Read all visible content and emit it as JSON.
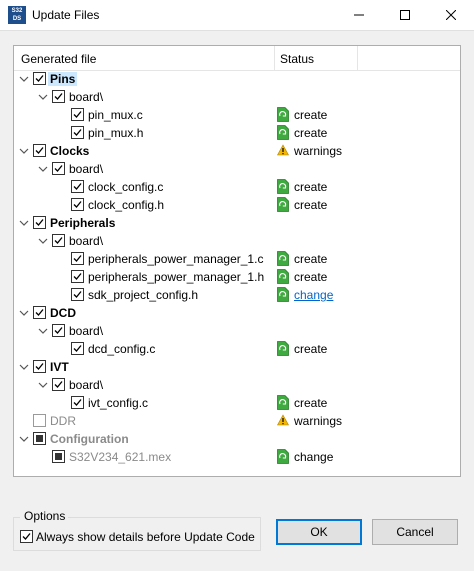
{
  "window": {
    "title": "Update Files",
    "app_icon_text": [
      "S32",
      "DS"
    ]
  },
  "columns": {
    "file": "Generated file",
    "status": "Status"
  },
  "tree": [
    {
      "depth": 0,
      "label": "Pins",
      "chevron": true,
      "check": "checked",
      "bold": true,
      "selected": true
    },
    {
      "depth": 1,
      "label": "board\\",
      "chevron": true,
      "check": "checked"
    },
    {
      "depth": 2,
      "label": "pin_mux.c",
      "check": "checked",
      "status": "create",
      "status_icon": "file-create-icon"
    },
    {
      "depth": 2,
      "label": "pin_mux.h",
      "check": "checked",
      "status": "create",
      "status_icon": "file-create-icon"
    },
    {
      "depth": 0,
      "label": "Clocks",
      "chevron": true,
      "check": "checked",
      "bold": true,
      "status": "warnings",
      "status_icon": "warning-icon"
    },
    {
      "depth": 1,
      "label": "board\\",
      "chevron": true,
      "check": "checked"
    },
    {
      "depth": 2,
      "label": "clock_config.c",
      "check": "checked",
      "status": "create",
      "status_icon": "file-create-icon"
    },
    {
      "depth": 2,
      "label": "clock_config.h",
      "check": "checked",
      "status": "create",
      "status_icon": "file-create-icon"
    },
    {
      "depth": 0,
      "label": "Peripherals",
      "chevron": true,
      "check": "checked",
      "bold": true
    },
    {
      "depth": 1,
      "label": "board\\",
      "chevron": true,
      "check": "checked"
    },
    {
      "depth": 2,
      "label": "peripherals_power_manager_1.c",
      "check": "checked",
      "status": "create",
      "status_icon": "file-create-icon"
    },
    {
      "depth": 2,
      "label": "peripherals_power_manager_1.h",
      "check": "checked",
      "status": "create",
      "status_icon": "file-create-icon"
    },
    {
      "depth": 2,
      "label": "sdk_project_config.h",
      "check": "checked",
      "status": "change",
      "status_icon": "file-create-icon",
      "link": true
    },
    {
      "depth": 0,
      "label": "DCD",
      "chevron": true,
      "check": "checked",
      "bold": true
    },
    {
      "depth": 1,
      "label": "board\\",
      "chevron": true,
      "check": "checked"
    },
    {
      "depth": 2,
      "label": "dcd_config.c",
      "check": "checked",
      "status": "create",
      "status_icon": "file-create-icon"
    },
    {
      "depth": 0,
      "label": "IVT",
      "chevron": true,
      "check": "checked",
      "bold": true
    },
    {
      "depth": 1,
      "label": "board\\",
      "chevron": true,
      "check": "checked"
    },
    {
      "depth": 2,
      "label": "ivt_config.c",
      "check": "checked",
      "status": "create",
      "status_icon": "file-create-icon"
    },
    {
      "depth": 0,
      "label": "DDR",
      "check": "unchecked",
      "grey": true,
      "status": "warnings",
      "status_icon": "warning-icon"
    },
    {
      "depth": 0,
      "label": "Configuration",
      "chevron": true,
      "check": "partial",
      "bold": true,
      "grey": true
    },
    {
      "depth": 1,
      "label": "S32V234_621.mex",
      "check": "partial",
      "grey": true,
      "status": "change",
      "status_icon": "file-create-icon"
    }
  ],
  "options": {
    "legend": "Options",
    "show_details_label": "Always show details before Update Code",
    "show_details_checked": true
  },
  "buttons": {
    "ok": "OK",
    "cancel": "Cancel"
  },
  "colors": {
    "accent": "#0078d7",
    "create_icon": "#3faa3f",
    "warning_icon": "#f2b705",
    "link": "#0066cc"
  }
}
